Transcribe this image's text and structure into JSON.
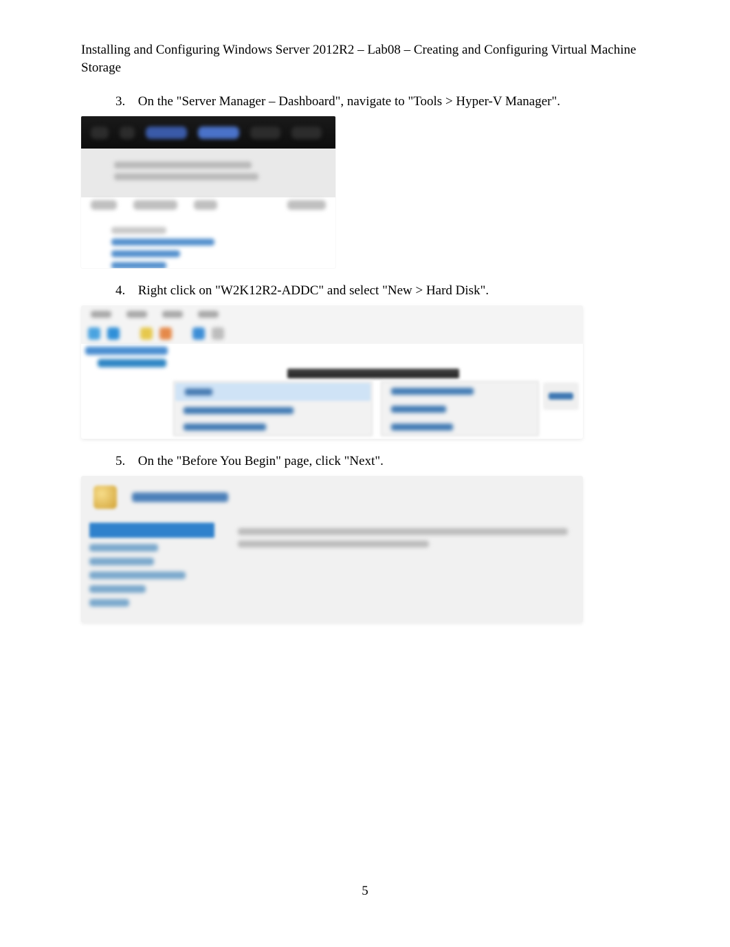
{
  "header": {
    "line": "Installing and Configuring Windows Server 2012R2 – Lab08 – Creating and Configuring Virtual Machine Storage"
  },
  "steps": [
    {
      "num": "3.",
      "text": "On the \"Server Manager – Dashboard\", navigate to \"Tools > Hyper-V Manager\"."
    },
    {
      "num": "4.",
      "text": "Right click on \"W2K12R2-ADDC\" and select \"New > Hard Disk\"."
    },
    {
      "num": "5.",
      "text": "On the \"Before You Begin\" page, click \"Next\"."
    }
  ],
  "page_number": "5"
}
